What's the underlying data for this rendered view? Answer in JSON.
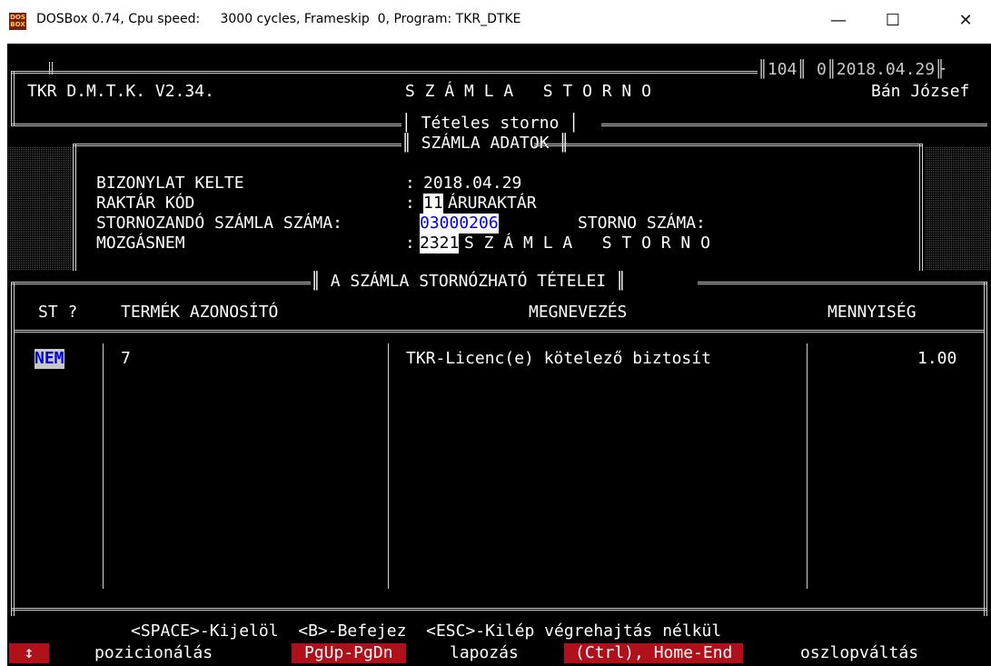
{
  "window": {
    "title": "DOSBox 0.74, Cpu speed:     3000 cycles, Frameskip  0, Program: TKR_DTKE",
    "app_icon_text": "DOS BOX",
    "minimize": "—",
    "maximize": "☐",
    "close": "✕"
  },
  "header": {
    "app_name": "TKR D.M.T.K. V2.34.",
    "screen_title": "S Z Á M L A   S T O R N O",
    "counter1": "104",
    "counter2": "0",
    "date": "2018.04.29",
    "user": "Bán József",
    "subtitle": "Tételes storno"
  },
  "invoice_panel": {
    "title": "SZÁMLA ADATOK",
    "doc_date_label": "BIZONYLAT KELTE",
    "doc_date_value": "2018.04.29",
    "warehouse_label": "RAKTÁR KÓD",
    "warehouse_code": "11",
    "warehouse_name": "ÁRURAKTÁR",
    "invoice_no_label": "STORNOZANDÓ SZÁMLA SZÁMA:",
    "invoice_no_value": "03000206",
    "storno_no_label": "STORNO SZÁMA:",
    "movement_label": "MOZGÁSNEM",
    "movement_code": "2321",
    "movement_name": "S Z Á M L A   S T O R N O",
    "colon": ":"
  },
  "items_table": {
    "title": "A SZÁMLA STORNÓZHATÓ TÉTELEI",
    "columns": [
      "ST ?",
      "TERMÉK AZONOSÍTÓ",
      "MEGNEVEZÉS",
      "MENNYISÉG"
    ],
    "rows": [
      {
        "st": "NEM",
        "product_id": "7",
        "name": "TKR-Licenc(e) kötelező biztosít",
        "qty": "1.00"
      }
    ]
  },
  "footer": {
    "line1": "<SPACE>-Kijelöl  <B>-Befejez  <ESC>-Kilép végrehajtás nélkül",
    "arrow_key": "↕",
    "arrow_desc": "pozicionálás",
    "pg_key": "PgUp-PgDn",
    "pg_desc": "lapozás",
    "ctrl_key": "(Ctrl), Home-End",
    "ctrl_desc": "oszlopváltás"
  },
  "colors": {
    "dos_bg": "#000000",
    "dos_fg": "#c8c8c8",
    "highlight_blue": "#0000d8",
    "key_red": "#b0101a"
  }
}
